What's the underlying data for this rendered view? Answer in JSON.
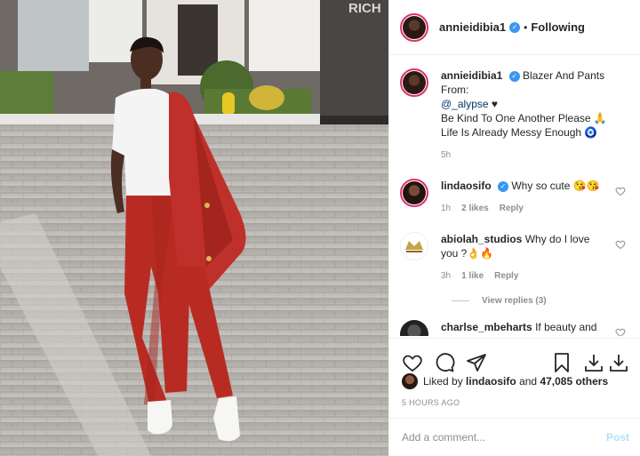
{
  "post": {
    "username": "annieidibia1",
    "verified": true,
    "follow_state": "Following",
    "building_sign": "RICH"
  },
  "caption": {
    "username": "annieidibia1",
    "line1": "Blazer And Pants From:",
    "mention": "@_alypse",
    "line2_suffix": "♥",
    "line3": "Be Kind To One Another Please 🙏",
    "line4": "Life Is Already Messy Enough 🧿",
    "time": "5h"
  },
  "comments": [
    {
      "username": "lindaosifo",
      "verified": true,
      "text": "Why so cute 😘😘",
      "time": "1h",
      "likes": "2 likes",
      "reply": "Reply"
    },
    {
      "username": "abiolah_studios",
      "text": "Why do I love you ?👌🔥",
      "time": "3h",
      "likes": "1 like",
      "reply": "Reply"
    },
    {
      "username": "charlse_mbeharts",
      "text": "If beauty and cuteness was a human being it"
    }
  ],
  "view_replies": "View replies (3)",
  "liked_by": {
    "prefix": "Liked by",
    "user": "lindaosifo",
    "and": "and",
    "others": "47,085 others"
  },
  "time_ago": "5 HOURS AGO",
  "add_comment": {
    "placeholder": "Add a comment...",
    "post_label": "Post"
  },
  "colors": {
    "verified": "#3897f0",
    "link": "#003569",
    "muted": "#8e8e8e",
    "post_disabled": "#b2dffc",
    "outfit_red": "#b82b23"
  },
  "icons": [
    "heart-icon",
    "comment-icon",
    "share-icon",
    "bookmark-icon",
    "download-icon"
  ]
}
